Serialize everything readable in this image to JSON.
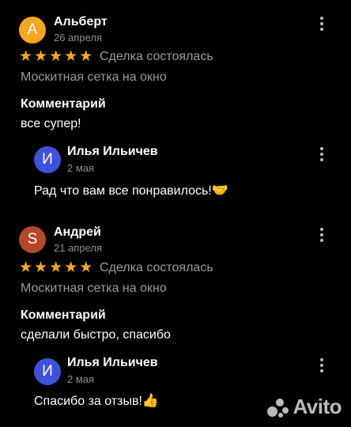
{
  "reviews": [
    {
      "avatar_letter": "А",
      "avatar_color": "#f5a623",
      "author": "Альберт",
      "date": "26 апреля",
      "rating": 5,
      "deal_status": "Сделка состоялась",
      "product": "Москитная сетка на окно",
      "comment_title": "Комментарий",
      "comment": "все супер!",
      "reply": {
        "avatar_letter": "И",
        "avatar_color": "#3f51d8",
        "author": "Илья Ильичев",
        "date": "2 мая",
        "text": "Рад что вам все понравилось!",
        "emoji": "🤝"
      }
    },
    {
      "avatar_letter": "S",
      "avatar_color": "#b5472a",
      "author": "Андрей",
      "date": "21 апреля",
      "rating": 5,
      "deal_status": "Сделка состоялась",
      "product": "Москитная сетка на окно",
      "comment_title": "Комментарий",
      "comment": "сделали быстро, спасибо",
      "reply": {
        "avatar_letter": "И",
        "avatar_color": "#3f51d8",
        "author": "Илья Ильичев",
        "date": "2 мая",
        "text": "Спасибо за отзыв!",
        "emoji": "👍"
      }
    }
  ],
  "watermark": {
    "text": "Avito",
    "icon": "avito-logo-icon"
  }
}
